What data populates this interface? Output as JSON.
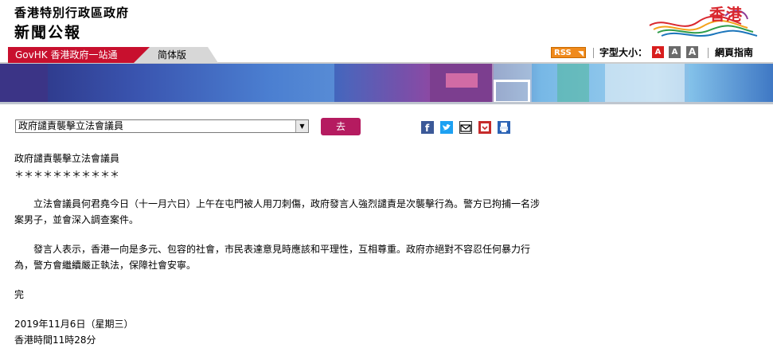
{
  "header": {
    "gov_name": "香港特別行政區政府",
    "section_title": "新聞公報",
    "brand_text": "香港"
  },
  "nav": {
    "govhk_tab": "GovHK 香港政府一站通",
    "simplified_tab": "简体版",
    "rss_label": "RSS",
    "font_size_label": "字型大小：",
    "font_buttons": [
      "A",
      "A",
      "A"
    ],
    "guide_label": "網頁指南"
  },
  "controls": {
    "select_value": "政府譴責襲擊立法會議員",
    "go_label": "去"
  },
  "share_icons": [
    "facebook-icon",
    "twitter-icon",
    "email-icon",
    "download-icon",
    "print-icon"
  ],
  "article": {
    "title": "政府譴責襲擊立法會議員",
    "stars": "＊＊＊＊＊＊＊＊＊＊＊",
    "paragraph1": "立法會議員何君堯今日（十一月六日）上午在屯門被人用刀刺傷，政府發言人強烈譴責是次襲擊行為。警方已拘捕一名涉案男子，並會深入調查案件。",
    "paragraph2": "發言人表示，香港一向是多元、包容的社會，市民表達意見時應該和平理性，互相尊重。政府亦絕對不容忍任何暴力行為，警方會繼續嚴正執法，保障社會安寧。",
    "end": "完",
    "date": "2019年11月6日（星期三）",
    "time": "香港時間11時28分"
  },
  "colors": {
    "accent_red": "#c8102e",
    "go_button": "#b51b60",
    "rss_orange": "#f08a1c"
  }
}
